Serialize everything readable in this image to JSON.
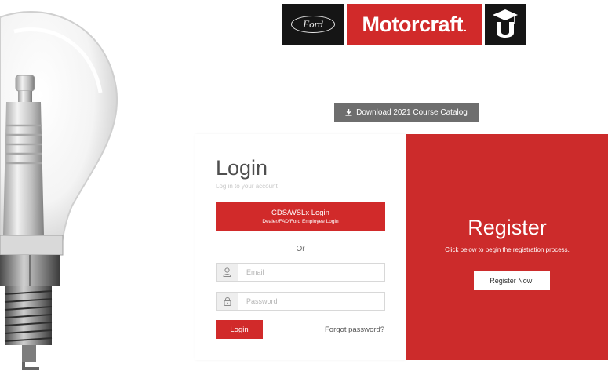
{
  "branding": {
    "ford_label": "Ford",
    "motorcraft_label": "Motorcraft",
    "motorcraft_dot": ".",
    "brand_red": "#d12a2a",
    "brand_black": "#151515",
    "icons": [
      "lightbulb-spark-plug-image",
      "graduation-cap-u-icon",
      "download-icon",
      "user-icon",
      "lock-icon"
    ]
  },
  "download": {
    "label": "Download 2021 Course Catalog"
  },
  "login": {
    "title": "Login",
    "subtitle": "Log in to your account",
    "sso_button": {
      "label": "CDS/WSLx Login",
      "sublabel": "Dealer/FAD/Ford Employee Login"
    },
    "divider_text": "Or",
    "email": {
      "placeholder": "Email",
      "value": ""
    },
    "password": {
      "placeholder": "Password",
      "value": ""
    },
    "submit_label": "Login",
    "forgot_label": "Forgot password?"
  },
  "register": {
    "title": "Register",
    "subtitle": "Click below to begin the registration process.",
    "button_label": "Register Now!"
  }
}
